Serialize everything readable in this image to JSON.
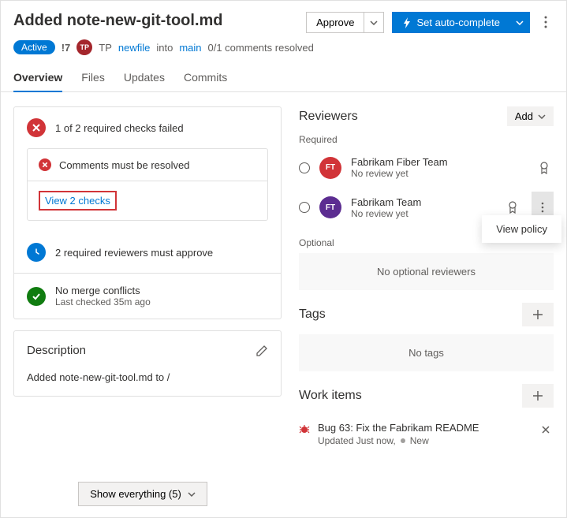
{
  "header": {
    "title": "Added note-new-git-tool.md",
    "approve": "Approve",
    "autocomplete": "Set auto-complete"
  },
  "meta": {
    "status": "Active",
    "prId": "!7",
    "avatarText": "TP",
    "author": "TP",
    "sourceBranch": "newfile",
    "into": "into",
    "targetBranch": "main",
    "commentsResolved": "0/1 comments resolved"
  },
  "tabs": [
    "Overview",
    "Files",
    "Updates",
    "Commits"
  ],
  "checks": {
    "failed": "1 of 2 required checks failed",
    "commentsMustResolve": "Comments must be resolved",
    "viewChecks": "View 2 checks",
    "reviewersMustApprove": "2 required reviewers must approve",
    "noMergeConflicts": "No merge conflicts",
    "lastChecked": "Last checked 35m ago"
  },
  "description": {
    "title": "Description",
    "text": "Added note-new-git-tool.md to /"
  },
  "reviewers": {
    "title": "Reviewers",
    "add": "Add",
    "requiredLabel": "Required",
    "list": [
      {
        "initials": "FT",
        "name": "Fabrikam Fiber Team",
        "status": "No review yet",
        "color": "#d13438"
      },
      {
        "initials": "FT",
        "name": "Fabrikam Team",
        "status": "No review yet",
        "color": "#5c2d91"
      }
    ],
    "optionalLabel": "Optional",
    "noOptional": "No optional reviewers",
    "menuItem": "View policy"
  },
  "tags": {
    "title": "Tags",
    "empty": "No tags"
  },
  "workItems": {
    "title": "Work items",
    "item": {
      "title": "Bug 63: Fix the Fabrikam README",
      "updated": "Updated Just now,",
      "state": "New"
    }
  },
  "footer": {
    "showEverything": "Show everything (5)"
  }
}
